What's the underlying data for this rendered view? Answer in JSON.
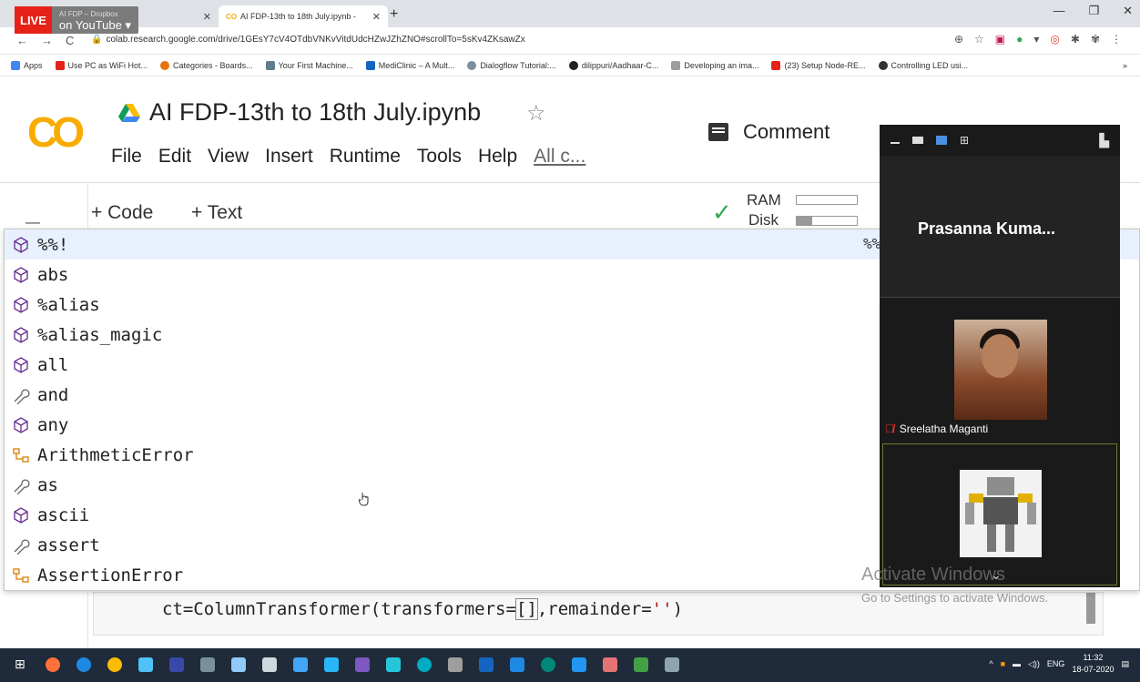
{
  "stream": {
    "live_badge": "LIVE",
    "live_text": "on YouTube",
    "live_sub": "AI FDP – Dropbox"
  },
  "browser": {
    "tab2_title": "AI FDP-13th to 18th July.ipynb -",
    "tab_close": "✕",
    "new_tab": "+",
    "url": "colab.research.google.com/drive/1GEsY7cV4OTdbVNKvVitdUdcHZwJZhZNO#scrollTo=5sKv4ZKsawZx",
    "bookmarks": [
      "Apps",
      "Use PC as WiFi Hot...",
      "Categories - Boards...",
      "Your First Machine...",
      "MediClinic – A Mult...",
      "Dialogflow Tutorial:...",
      "dilippuri/Aadhaar-C...",
      "Developing an ima...",
      "(23) Setup Node-RE...",
      "Controlling LED usi..."
    ],
    "bookmark_more": "»"
  },
  "colab": {
    "logo": "CO",
    "title": "AI FDP-13th to 18th July.ipynb",
    "menu": [
      "File",
      "Edit",
      "View",
      "Insert",
      "Runtime",
      "Tools",
      "Help"
    ],
    "menu_more": "All c...",
    "comment": "Comment",
    "add_code": "+ Code",
    "add_text": "+ Text",
    "ram_label": "RAM",
    "disk_label": "Disk",
    "disk_usage": 0.26
  },
  "autocomplete": {
    "right_text": "%%",
    "items": [
      {
        "label": "%%!",
        "icon": "cube-icon"
      },
      {
        "label": "abs",
        "icon": "cube-icon"
      },
      {
        "label": "%alias",
        "icon": "cube-icon"
      },
      {
        "label": "%alias_magic",
        "icon": "cube-icon"
      },
      {
        "label": "all",
        "icon": "cube-icon"
      },
      {
        "label": "and",
        "icon": "wrench-icon"
      },
      {
        "label": "any",
        "icon": "cube-icon"
      },
      {
        "label": "ArithmeticError",
        "icon": "class-icon"
      },
      {
        "label": "as",
        "icon": "wrench-icon"
      },
      {
        "label": "ascii",
        "icon": "cube-icon"
      },
      {
        "label": "assert",
        "icon": "wrench-icon"
      },
      {
        "label": "AssertionError",
        "icon": "class-icon"
      }
    ]
  },
  "code": {
    "pre": "ct=ColumnTransformer(transformers=",
    "bracket": "[]",
    "mid": ",remainder=",
    "str": "''",
    "post": ")"
  },
  "watermark": {
    "line1": "Activate Windows",
    "line2": "Go to Settings to activate Windows."
  },
  "video": {
    "host_name": "Prasanna Kuma...",
    "participant1": "Sreelatha Maganti"
  },
  "taskbar": {
    "lang": "ENG",
    "time": "11:32",
    "date": "18-07-2020"
  },
  "colors": {
    "colab_orange": "#f9ab00",
    "selection_bg": "#e8f0fe",
    "live_red": "#e62117",
    "taskbar_bg": "#1f2a3a"
  }
}
